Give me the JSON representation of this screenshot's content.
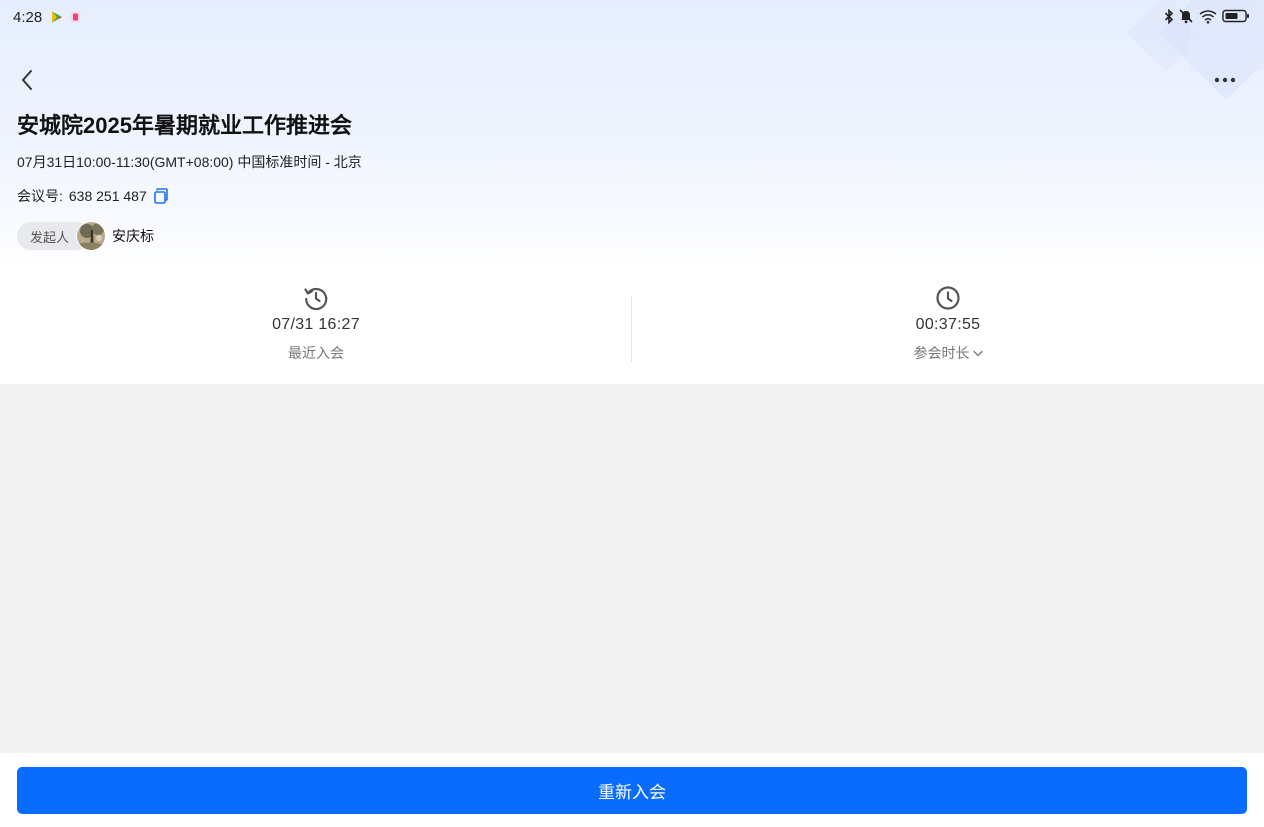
{
  "status_bar": {
    "time": "4:28",
    "icons": [
      "play-store-icon",
      "app-notification-icon",
      "bluetooth-icon",
      "mute-icon",
      "wifi-icon",
      "battery-icon"
    ]
  },
  "header": {
    "back_icon": "chevron-left-icon",
    "more_icon": "more-horizontal-icon"
  },
  "meeting": {
    "title": "安城院2025年暑期就业工作推进会",
    "time_range": "07月31日10:00-11:30(GMT+08:00) 中国标准时间 - 北京",
    "id_label": "会议号:",
    "id_value": "638 251 487",
    "host_tag": "发起人",
    "host_name": "安庆标"
  },
  "stats": {
    "last_join": {
      "icon": "history-icon",
      "value": "07/31 16:27",
      "label": "最近入会"
    },
    "duration": {
      "icon": "clock-icon",
      "value": "00:37:55",
      "label": "参会时长"
    }
  },
  "footer": {
    "rejoin_label": "重新入会"
  },
  "colors": {
    "primary": "#0a6cff",
    "copy_icon": "#1a73e8",
    "background": "#f2f2f2"
  }
}
